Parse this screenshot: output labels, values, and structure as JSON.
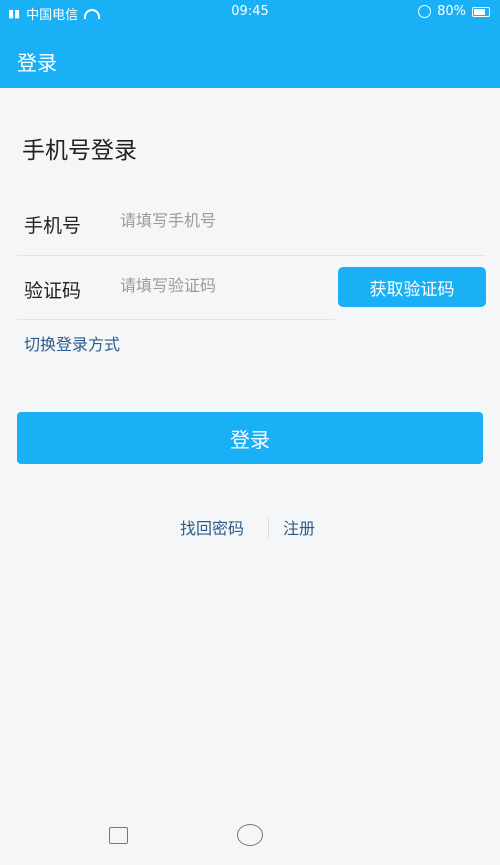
{
  "status_bar": {
    "carrier": "中国电信",
    "time": "09:45",
    "battery": "80%",
    "battery_level": 0.8,
    "icons": [
      "signal-icon",
      "wifi-icon",
      "alarm-icon",
      "battery-icon"
    ]
  },
  "header": {
    "title": "登录",
    "background": "#1ab0f6"
  },
  "form": {
    "title": "手机号登录",
    "phone": {
      "label": "手机号",
      "placeholder": "请填写手机号",
      "value": ""
    },
    "code": {
      "label": "验证码",
      "placeholder": "请填写验证码",
      "value": ""
    },
    "get_code_button": "获取验证码",
    "switch_mode_link": "切换登录方式",
    "submit_button": "登录"
  },
  "links": {
    "find_password": "找回密码",
    "register": "注册"
  },
  "navbar": {
    "icons": [
      "recent-apps-icon",
      "home-icon"
    ]
  },
  "colors": {
    "accent": "#1ab0f6",
    "link": "#2b5b8a",
    "background": "#f5f6f7"
  }
}
